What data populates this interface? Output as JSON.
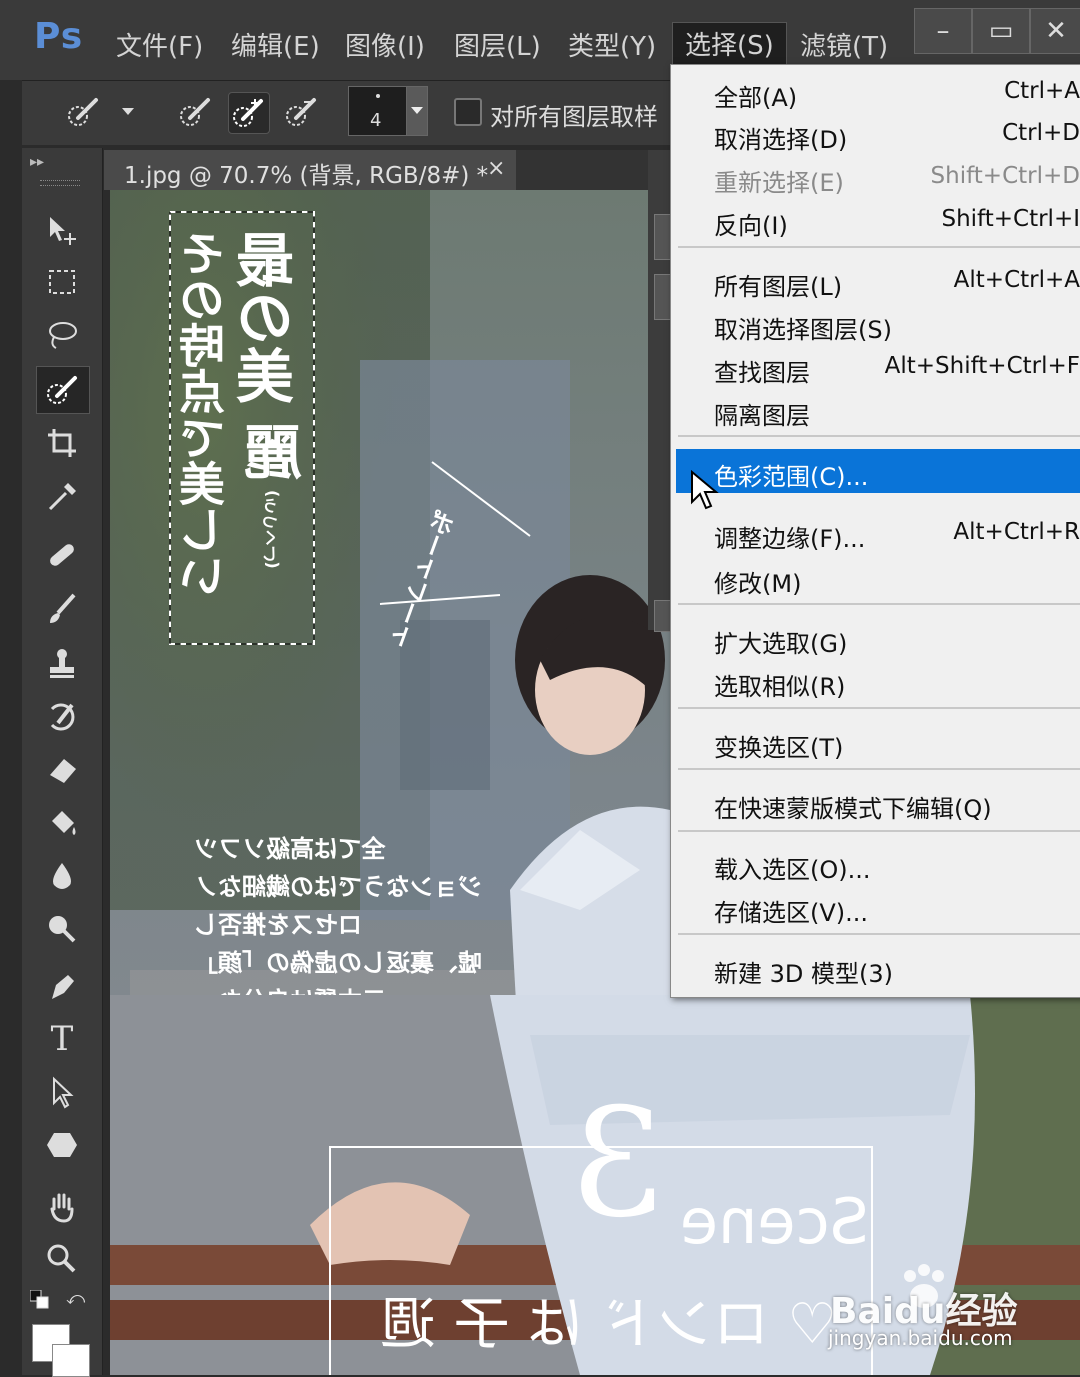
{
  "app": {
    "logo": "Ps"
  },
  "menubar": {
    "items": [
      "文件(F)",
      "编辑(E)",
      "图像(I)",
      "图层(L)",
      "类型(Y)",
      "选择(S)",
      "滤镜(T)"
    ],
    "open_menu": "选择(S)",
    "window_controls": {
      "minimize": "–",
      "maximize": "▭",
      "close": "✕"
    }
  },
  "options_bar": {
    "brush_size": "4",
    "sample_all_layers_label": "对所有图层取样",
    "sample_all_layers_checked": false
  },
  "document": {
    "tab_title": "1.jpg @ 70.7% (背景, RGB/8#) *",
    "tab_close": "×"
  },
  "select_menu": {
    "items": [
      {
        "label": "全部(A)",
        "shortcut": "Ctrl+A",
        "enabled": true
      },
      {
        "label": "取消选择(D)",
        "shortcut": "Ctrl+D",
        "enabled": true
      },
      {
        "label": "重新选择(E)",
        "shortcut": "Shift+Ctrl+D",
        "enabled": false
      },
      {
        "label": "反向(I)",
        "shortcut": "Shift+Ctrl+I",
        "enabled": true
      },
      {
        "label": "所有图层(L)",
        "shortcut": "Alt+Ctrl+A",
        "enabled": true
      },
      {
        "label": "取消选择图层(S)",
        "shortcut": "",
        "enabled": true
      },
      {
        "label": "查找图层",
        "shortcut": "Alt+Shift+Ctrl+F",
        "enabled": true
      },
      {
        "label": "隔离图层",
        "shortcut": "",
        "enabled": true
      },
      {
        "label": "色彩范围(C)...",
        "shortcut": "",
        "enabled": true,
        "highlighted": true
      },
      {
        "label": "调整边缘(F)...",
        "shortcut": "Alt+Ctrl+R",
        "enabled": true
      },
      {
        "label": "修改(M)",
        "shortcut": "",
        "enabled": true
      },
      {
        "label": "扩大选取(G)",
        "shortcut": "",
        "enabled": true
      },
      {
        "label": "选取相似(R)",
        "shortcut": "",
        "enabled": true
      },
      {
        "label": "变换选区(T)",
        "shortcut": "",
        "enabled": true
      },
      {
        "label": "在快速蒙版模式下编辑(Q)",
        "shortcut": "",
        "enabled": true
      },
      {
        "label": "载入选区(O)...",
        "shortcut": "",
        "enabled": true
      },
      {
        "label": "存储选区(V)...",
        "shortcut": "",
        "enabled": true
      },
      {
        "label": "新建 3D 模型(3)",
        "shortcut": "",
        "enabled": true
      }
    ]
  },
  "canvas_text": {
    "vertical_main": "最の美",
    "vertical_line2": "麗",
    "vertical_small": "(うつくし)",
    "vertical_sub": "その時点で美しい",
    "side_note": "ポートレート",
    "paragraph": [
      "全ては高級ソフツ",
      "ジョンなうではの繊細なノ",
      "ロセスを推否し",
      "嘘、裏返しの虚偽の「顔」",
      "元本質は自分な。"
    ],
    "scene_number": "3",
    "scene_word": "Scene",
    "bottom_caption": "♡ ロンド は 子 週"
  },
  "watermark": {
    "brand": "Baidu经验",
    "url": "jingyan.baidu.com"
  },
  "colors": {
    "highlight": "#0a74d8",
    "ps_logo": "#5b8ed6",
    "ui_dark": "#3a3a3a"
  }
}
